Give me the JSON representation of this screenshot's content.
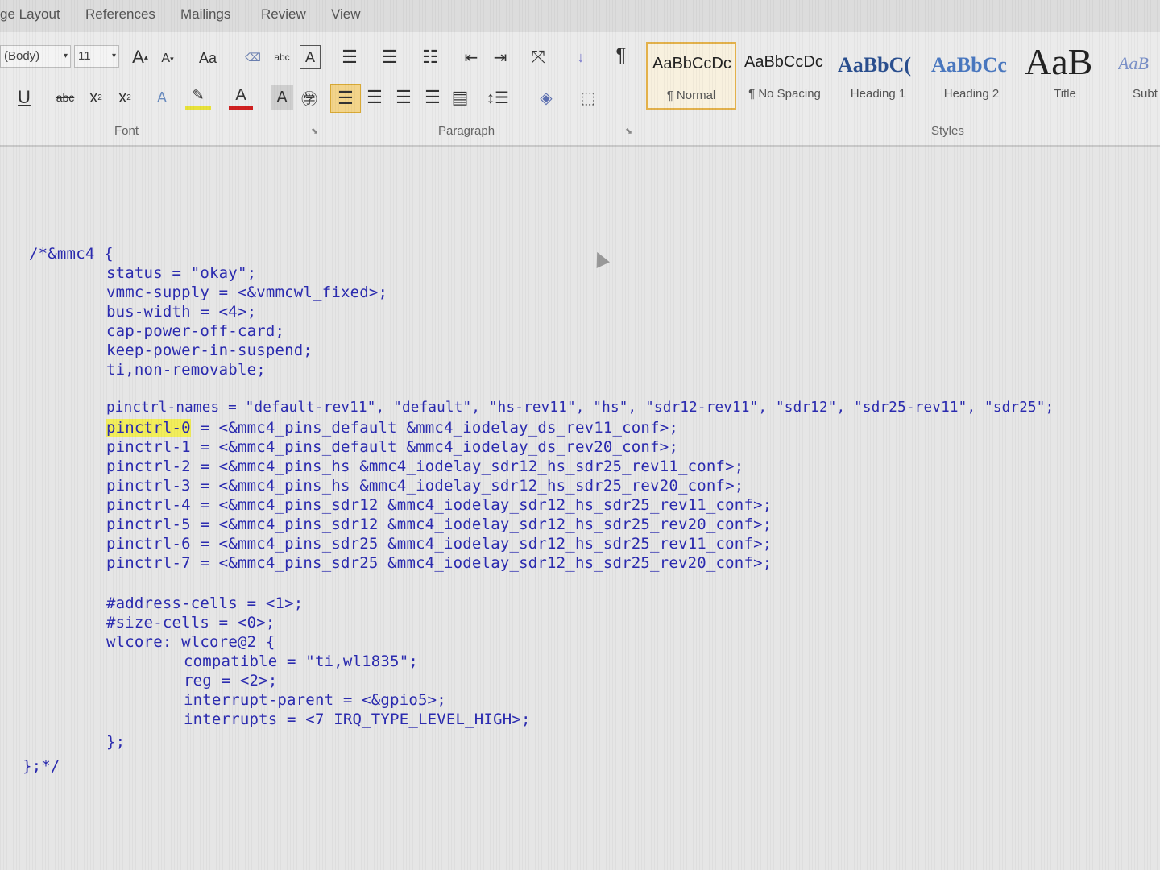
{
  "tabs": [
    "ge Layout",
    "References",
    "Mailings",
    "Review",
    "View"
  ],
  "ribbon": {
    "font_name": "(Body)",
    "font_size": "11",
    "group_font": "Font",
    "group_paragraph": "Paragraph",
    "group_styles": "Styles",
    "styles": [
      {
        "sample": "AaBbCcDc",
        "name": "¶ Normal",
        "selected": true
      },
      {
        "sample": "AaBbCcDc",
        "name": "¶ No Spacing"
      },
      {
        "sample": "AaBbC(",
        "name": "Heading 1"
      },
      {
        "sample": "AaBbCc",
        "name": "Heading 2"
      },
      {
        "sample": "AaB",
        "name": "Title"
      },
      {
        "sample": "AaB",
        "name": "Subt"
      }
    ]
  },
  "code": {
    "l1": "/*&mmc4 {",
    "l2": "status = \"okay\";",
    "l3": "vmmc-supply = <&vmmcwl_fixed>;",
    "l4": "bus-width = <4>;",
    "l5": "cap-power-off-card;",
    "l6": "keep-power-in-suspend;",
    "l7": "ti,non-removable;",
    "l8": "pinctrl-names = \"default-rev11\", \"default\", \"hs-rev11\", \"hs\", \"sdr12-rev11\", \"sdr12\", \"sdr25-rev11\", \"sdr25\";",
    "l9a": "pinctrl-0",
    "l9b": " = <&mmc4_pins_default &mmc4_iodelay_ds_rev11_conf>;",
    "l10": "pinctrl-1 = <&mmc4_pins_default &mmc4_iodelay_ds_rev20_conf>;",
    "l11": "pinctrl-2 = <&mmc4_pins_hs &mmc4_iodelay_sdr12_hs_sdr25_rev11_conf>;",
    "l12": "pinctrl-3 = <&mmc4_pins_hs &mmc4_iodelay_sdr12_hs_sdr25_rev20_conf>;",
    "l13": "pinctrl-4 = <&mmc4_pins_sdr12 &mmc4_iodelay_sdr12_hs_sdr25_rev11_conf>;",
    "l14": "pinctrl-5 = <&mmc4_pins_sdr12 &mmc4_iodelay_sdr12_hs_sdr25_rev20_conf>;",
    "l15": "pinctrl-6 = <&mmc4_pins_sdr25 &mmc4_iodelay_sdr12_hs_sdr25_rev11_conf>;",
    "l16": "pinctrl-7 = <&mmc4_pins_sdr25 &mmc4_iodelay_sdr12_hs_sdr25_rev20_conf>;",
    "l17": "#address-cells = <1>;",
    "l18": "#size-cells = <0>;",
    "l19a": "wlcore: ",
    "l19b": "wlcore@2",
    "l19c": " {",
    "l20": "compatible = \"ti,wl1835\";",
    "l21": "reg = <2>;",
    "l22": "interrupt-parent = <&gpio5>;",
    "l23": "interrupts = <7 IRQ_TYPE_LEVEL_HIGH>;",
    "l24": "};",
    "l25": "};*/"
  }
}
